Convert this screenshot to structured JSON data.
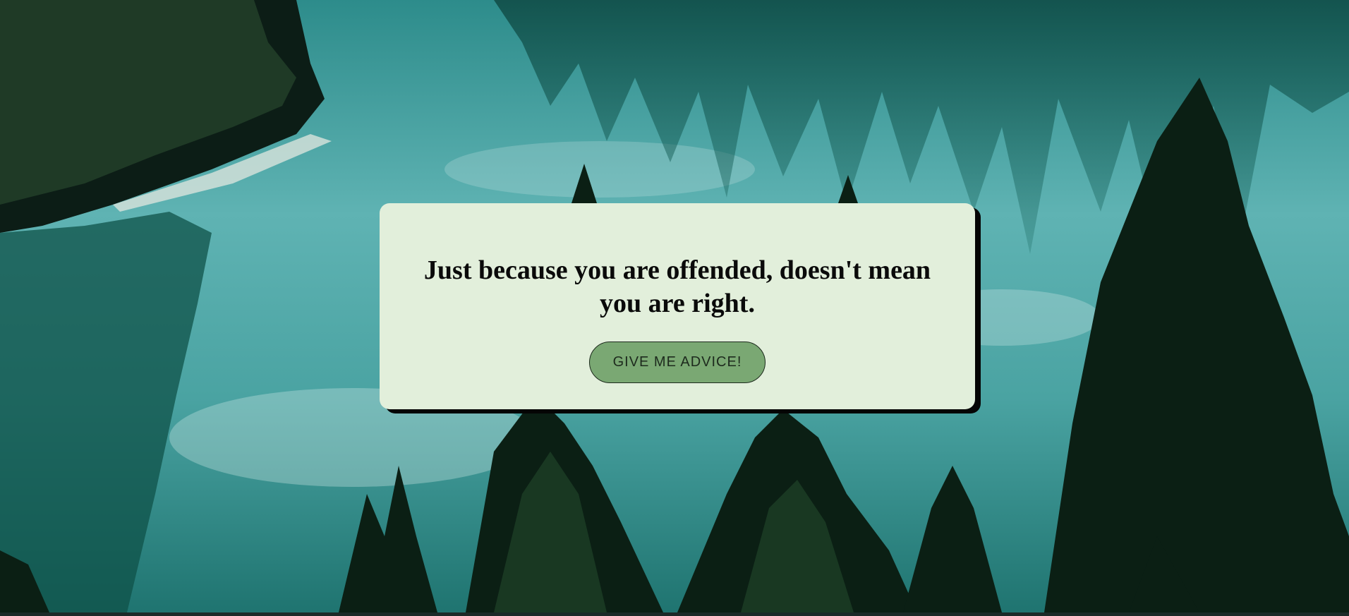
{
  "card": {
    "quote": "Just because you are offended, doesn't mean you are right.",
    "button_label": "GIVE ME ADVICE!"
  },
  "colors": {
    "card_background": "#e2efdb",
    "button_background": "#7aa873",
    "text": "#0a0a0a"
  }
}
